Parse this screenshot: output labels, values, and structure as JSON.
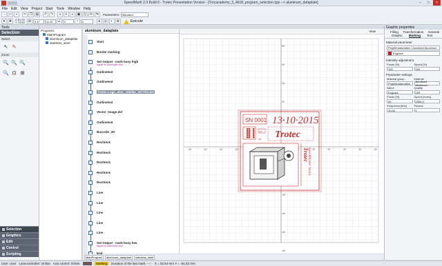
{
  "window": {
    "title": "SpeedMarK 2.0 Build 0 - Trotec Presentation Version - [Trocacademy_3_4b18_program_selection.tpjs --> aluminum_dataplate]",
    "controls": [
      "–",
      "□",
      "×"
    ]
  },
  "menu": [
    "File",
    "Edit",
    "View",
    "Project",
    "Start",
    "Tools",
    "Window",
    "Help"
  ],
  "toolbar": {
    "coords": {
      "x_label": "X",
      "x_value": "81,00",
      "y_label": "Y",
      "y_value": "70,50"
    },
    "transform_fields": {
      "field1": "0,47",
      "field2": "11,00",
      "field3": "0",
      "field4": "0"
    },
    "parameter_label": "Parameters:",
    "parameter_value": "Standard",
    "execute_label": "Execute"
  },
  "left_panel": {
    "title": "Tools",
    "header": "Selection",
    "select_label": "Select",
    "zoom_label": "Zoom",
    "accordion": [
      "Selection",
      "Graphics",
      "Edit",
      "Control",
      "Scripting"
    ]
  },
  "tree": {
    "root": "Programs",
    "items": [
      "MainProgram",
      "aluminum_dataplate",
      "stainless_steel"
    ]
  },
  "program": {
    "title": "aluminum_dataplate",
    "steps": [
      {
        "label": "Start",
        "sub": ""
      },
      {
        "label": "Border marking",
        "sub": ""
      },
      {
        "label": "Set Output - mark busy high",
        "sub": "signal for automatic door"
      },
      {
        "label": "Outlinetext",
        "sub": ""
      },
      {
        "label": "Outlinetext",
        "sub": ""
      },
      {
        "label": "Trotec-Logo_alun_Jubiläe_dxf File.dxf",
        "sub": ""
      },
      {
        "label": "Outlinetext",
        "sub": ""
      },
      {
        "label": "Vector_Image.dxf",
        "sub": ""
      },
      {
        "label": "Outlinetext",
        "sub": ""
      },
      {
        "label": "Barcode_2D",
        "sub": ""
      },
      {
        "label": "Rechteck",
        "sub": ""
      },
      {
        "label": "Rechteck",
        "sub": ""
      },
      {
        "label": "Rechteck",
        "sub": ""
      },
      {
        "label": "Rechteck",
        "sub": ""
      },
      {
        "label": "Rechteck",
        "sub": ""
      },
      {
        "label": "Line",
        "sub": ""
      },
      {
        "label": "Line",
        "sub": ""
      },
      {
        "label": "Line",
        "sub": ""
      },
      {
        "label": "Line",
        "sub": ""
      },
      {
        "label": "Line",
        "sub": ""
      },
      {
        "label": "Set Output - mark busy low",
        "sub": "signal for automatic door"
      },
      {
        "label": "End",
        "sub": ""
      }
    ]
  },
  "canvas": {
    "view_label": "View",
    "plate": {
      "serial": "SN 0001",
      "date": "13·10·2015",
      "brand": "Trotec",
      "small1": "1/8",
      "small2": "CE",
      "side_text_top": "Trotec",
      "side_text_bottom": "SpeedMarker Series"
    },
    "x_ticks": [
      "-60",
      "-50",
      "-40",
      "-30",
      "-20",
      "-10",
      "0",
      "10",
      "20",
      "30",
      "40",
      "50",
      "60"
    ],
    "y_ticks": [
      "50",
      "40",
      "30",
      "20",
      "10",
      "-10",
      "-20",
      "-30",
      "-40",
      "-50",
      "-60"
    ]
  },
  "right_panel": {
    "title": "Graphic properties",
    "tabs_row1": [
      "Filling",
      "Transformation",
      "General"
    ],
    "tabs_row2": [
      "Graphic",
      "Marking",
      "Text"
    ],
    "active_tab": "Marking",
    "material_parameter_label": "Material parameter",
    "material_value": "Projektmaterialien / Anodized Aluminum",
    "process_value": "Engrave",
    "intensity_label": "Intensity adjustment",
    "power_label": "Power [%]",
    "speed_label": "Speed [%]",
    "power_value": "100",
    "speed_value": "100",
    "param_settings_label": "Parameter settings",
    "params": [
      [
        "Material group",
        "Material"
      ],
      [
        "Projektmaterialien",
        "Anodized aluminum"
      ],
      [
        "Name",
        "Quality"
      ],
      [
        "Engrave",
        "100"
      ],
      [
        "Power [%]",
        "Speed [mm/s]"
      ],
      [
        "40",
        "2000,0"
      ],
      [
        "Frequency [kHz]",
        "Passes"
      ],
      [
        "20,00",
        "1"
      ]
    ]
  },
  "doc_tabs": [
    "MainProgram",
    "aluminum_dataplate",
    "stainless_steel"
  ],
  "status": {
    "user": "User: User",
    "laser": "Lasercontroller: Online",
    "axis": "Axis control: Online",
    "start": "Start",
    "marking": "Marking",
    "duration": "Duration of the last mark: --:--",
    "coords": "X = 62,54 mm  Y = -51,62 mm"
  },
  "colors": {
    "accent_red": "#c9302c",
    "brand_red": "#b3222a",
    "program_blue": "#2b64b8",
    "dark_panel": "#3e4650"
  }
}
